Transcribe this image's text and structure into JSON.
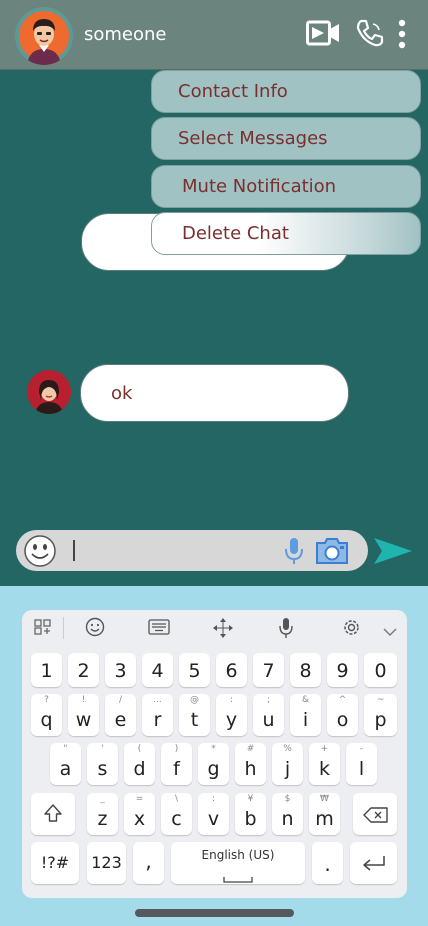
{
  "header": {
    "contact_name": "someone",
    "icons": [
      "avatar",
      "video-call-icon",
      "phone-icon",
      "more-vert-icon"
    ]
  },
  "menu": {
    "items": [
      "Contact Info",
      "Select Messages",
      "Mute Notification",
      "Delete Chat"
    ]
  },
  "messages": [
    {
      "sender": "me",
      "text": ""
    },
    {
      "sender": "other",
      "text": "ok"
    }
  ],
  "input": {
    "placeholder": "",
    "value": ""
  },
  "keyboard": {
    "toolbar": [
      "apps-icon",
      "emoji-icon",
      "keyboard-icon",
      "move-icon",
      "mic-icon",
      "settings-icon",
      "chevron-down-icon"
    ],
    "numbers": [
      "1",
      "2",
      "3",
      "4",
      "5",
      "6",
      "7",
      "8",
      "9",
      "0"
    ],
    "row1": [
      {
        "k": "q",
        "s": "?"
      },
      {
        "k": "w",
        "s": "!"
      },
      {
        "k": "e",
        "s": "/"
      },
      {
        "k": "r",
        "s": "..."
      },
      {
        "k": "t",
        "s": "@"
      },
      {
        "k": "y",
        "s": ":"
      },
      {
        "k": "u",
        "s": ";"
      },
      {
        "k": "i",
        "s": "&"
      },
      {
        "k": "o",
        "s": "^"
      },
      {
        "k": "p",
        "s": "~"
      }
    ],
    "row2": [
      {
        "k": "a",
        "s": "\""
      },
      {
        "k": "s",
        "s": "'"
      },
      {
        "k": "d",
        "s": "("
      },
      {
        "k": "f",
        "s": ")"
      },
      {
        "k": "g",
        "s": "*"
      },
      {
        "k": "h",
        "s": "#"
      },
      {
        "k": "j",
        "s": "%"
      },
      {
        "k": "k",
        "s": "+"
      },
      {
        "k": "l",
        "s": "-"
      }
    ],
    "row3": [
      {
        "k": "z",
        "s": "_"
      },
      {
        "k": "x",
        "s": "="
      },
      {
        "k": "c",
        "s": "\\"
      },
      {
        "k": "v",
        "s": ":"
      },
      {
        "k": "b",
        "s": "¥"
      },
      {
        "k": "n",
        "s": "$"
      },
      {
        "k": "m",
        "s": "₩"
      }
    ],
    "symbols_label": "!?#",
    "numbers_label": "123",
    "comma": ",",
    "space_label": "English (US)",
    "period": "."
  },
  "colors": {
    "header_bg": "#6c847e",
    "chat_bg": "#236663",
    "menu_bg": "#a0c2c3",
    "menu_text": "#7a2f2f",
    "send_accent": "#1fb4ad",
    "keyboard_bg": "#a3dbea"
  }
}
